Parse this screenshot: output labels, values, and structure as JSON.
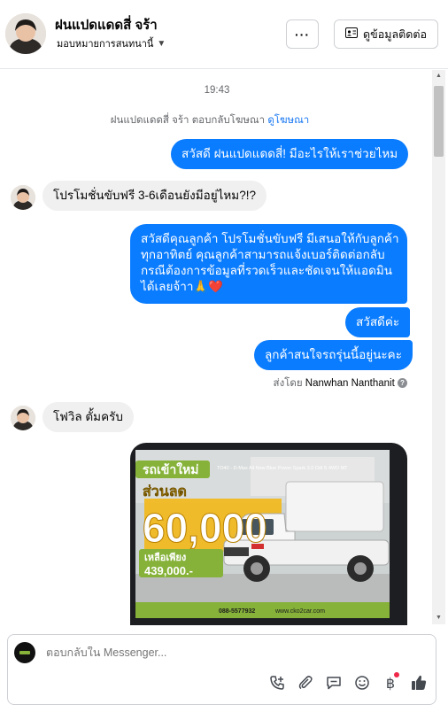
{
  "header": {
    "contact_name": "ฝนแปดแดดสี่ จร้า",
    "assignee_label": "มอบหมายการสนทนานี้",
    "more_label": "···",
    "contact_info_label": "ดูข้อมูลติดต่อ"
  },
  "thread": {
    "timestamp": "19:43",
    "ad_reply_text": "ฝนแปดแดดสี่ จร้า ตอบกลับโฆษณา",
    "ad_link_label": "ดูโฆษณา",
    "messages": [
      {
        "direction": "out",
        "text": "สวัสดี ฝนแปดแดดสี่! มีอะไรให้เราช่วยไหม"
      },
      {
        "direction": "in",
        "text": "โปรโมชั่นขับฟรี 3-6เดือนยังมีอยู่ไหม?!?"
      },
      {
        "direction": "out",
        "lines": [
          "สวัสดีคุณลูกค้า โปรโมชั่นขับฟรี มีเสนอให้กับลูกค้า",
          "ทุกอาทิตย์ คุณลูกค้าสามารถแจ้งเบอร์ติดต่อกลับ",
          "กรณีต้องการข้อมูลที่รวดเร็วและชัดเจนให้แอดมิน",
          "ได้เลยจ้าา🙏❤️"
        ]
      },
      {
        "direction": "out",
        "text": "สวัสดีค่ะ"
      },
      {
        "direction": "out",
        "text": "ลูกค้าสนใจรถรุ่นนี้อยู่นะคะ"
      },
      {
        "direction": "in",
        "text": "โฟวิล ตั้มครับ"
      }
    ],
    "sent_by_prefix": "ส่งโดย",
    "sent_by_name": "Nanwhan Nanthanit"
  },
  "ad_card": {
    "headline": "รถเข้าใหม่",
    "model": "TO40 - D-Max All New Blue Power Spark 3.0 Ddi S 4WD MT",
    "discount_label": "ส่วนลด",
    "discount_value": "60,000",
    "price_label": "เหลือเพียง",
    "price_value": "439,000.-",
    "phone": "088-5577932",
    "website": "www.cko2car.com"
  },
  "composer": {
    "placeholder": "ตอบกลับใน Messenger...",
    "icons": [
      "call-add-icon",
      "attach-icon",
      "saved-reply-icon",
      "emoji-icon",
      "currency-icon",
      "like-icon"
    ]
  },
  "colors": {
    "outgoing_bubble": "#0a7cff",
    "incoming_bubble": "#f0f0f0",
    "link": "#1877f2",
    "accent_yellow": "#f2b81b"
  }
}
